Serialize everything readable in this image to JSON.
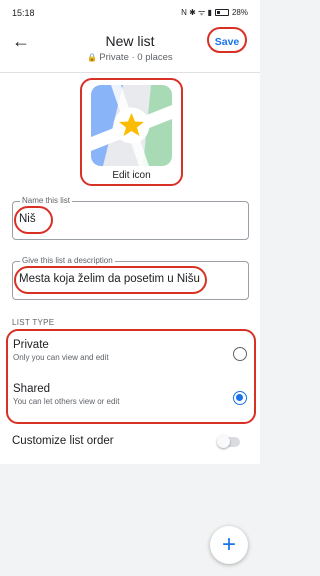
{
  "status_bar": {
    "time": "15:18",
    "icons_text": "N ✱ ᯤ ▮",
    "battery": "28%"
  },
  "header": {
    "back_icon": "arrow-back-icon",
    "title": "New list",
    "lock_icon": "🔒",
    "subtitle": "Private · 0 places",
    "save_label": "Save"
  },
  "icon_picker": {
    "label": "Edit icon",
    "icon": "star-map-icon"
  },
  "name_field": {
    "legend": "Name this list",
    "value": "Niš"
  },
  "description_field": {
    "legend": "Give this list a description",
    "value": "Mesta koja želim da posetim u Nišu"
  },
  "list_type": {
    "label": "LIST TYPE",
    "options": [
      {
        "title": "Private",
        "desc": "Only you can view and edit",
        "selected": false
      },
      {
        "title": "Shared",
        "desc": "You can let others view or edit",
        "selected": true
      }
    ]
  },
  "customize": {
    "label": "Customize list order",
    "enabled": false
  },
  "fab": {
    "label": "+"
  },
  "colors": {
    "accent": "#1a73e8",
    "highlight": "#d93025"
  }
}
